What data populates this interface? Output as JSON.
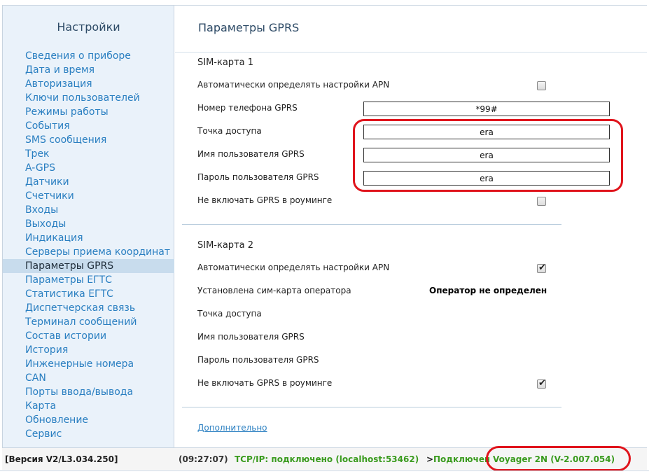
{
  "sidebar": {
    "title": "Настройки",
    "items": [
      {
        "label": "Сведения о приборе"
      },
      {
        "label": "Дата и время"
      },
      {
        "label": "Авторизация"
      },
      {
        "label": "Ключи пользователей"
      },
      {
        "label": "Режимы работы"
      },
      {
        "label": "События"
      },
      {
        "label": "SMS сообщения"
      },
      {
        "label": "Трек"
      },
      {
        "label": "A-GPS"
      },
      {
        "label": "Датчики"
      },
      {
        "label": "Счетчики"
      },
      {
        "label": "Входы"
      },
      {
        "label": "Выходы"
      },
      {
        "label": "Индикация"
      },
      {
        "label": "Серверы приема координат"
      },
      {
        "label": "Параметры GPRS"
      },
      {
        "label": "Параметры ЕГТС"
      },
      {
        "label": "Статистика ЕГТС"
      },
      {
        "label": "Диспетчерская связь"
      },
      {
        "label": "Терминал сообщений"
      },
      {
        "label": "Состав истории"
      },
      {
        "label": "История"
      },
      {
        "label": "Инженерные номера"
      },
      {
        "label": "CAN"
      },
      {
        "label": "Порты ввода/вывода"
      },
      {
        "label": "Карта"
      },
      {
        "label": "Обновление"
      },
      {
        "label": "Сервис"
      }
    ],
    "active_index": 15
  },
  "main": {
    "title": "Параметры GPRS",
    "sim1": {
      "title": "SIM-карта 1",
      "auto_apn_label": "Автоматически определять настройки APN",
      "auto_apn_checked": false,
      "phone_label": "Номер телефона GPRS",
      "phone_value": "*99#",
      "apn_label": "Точка доступа",
      "apn_value": "era",
      "user_label": "Имя пользователя GPRS",
      "user_value": "era",
      "password_label": "Пароль пользователя GPRS",
      "password_value": "era",
      "no_roaming_label": "Не включать GPRS в роуминге",
      "no_roaming_checked": false
    },
    "sim2": {
      "title": "SIM-карта 2",
      "auto_apn_label": "Автоматически определять настройки APN",
      "auto_apn_checked": true,
      "operator_label": "Установлена сим-карта оператора",
      "operator_value": "Оператор не определен",
      "apn_label": "Точка доступа",
      "user_label": "Имя пользователя GPRS",
      "password_label": "Пароль пользователя GPRS",
      "no_roaming_label": "Не включать GPRS в роуминге",
      "no_roaming_checked": true
    },
    "more_link": "Дополнительно"
  },
  "statusbar": {
    "version": "[Версия V2/L3.034.250]",
    "time": "(09:27:07)",
    "tcp": "TCP/IP: подключено (localhost:53462)",
    "arrow": ">",
    "connection": "Подключено",
    "device": "Voyager 2N (V-2.007.054)"
  },
  "colors": {
    "accent_link": "#2a7fc1",
    "status_green": "#3a9b1e",
    "highlight_red": "#e0141c",
    "sidebar_bg": "#eaf2fa",
    "active_bg": "#c8dced"
  },
  "icons": {
    "checkbox_checked": "check-mark-icon"
  }
}
